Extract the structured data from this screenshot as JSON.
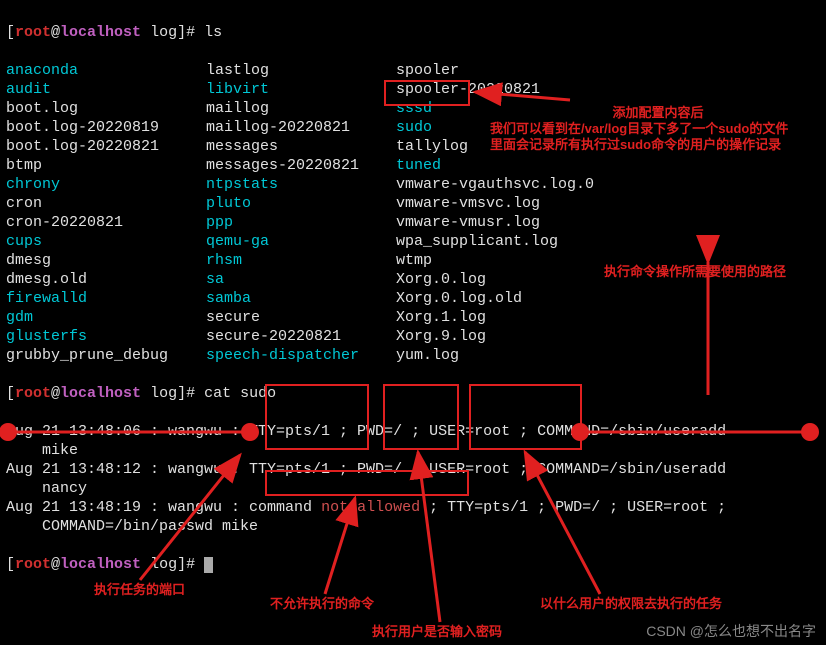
{
  "prompt": {
    "open": "[",
    "user": "root",
    "at": "@",
    "host": "localhost",
    "dir": " log",
    "close": "]# "
  },
  "cmd1": "ls",
  "cmd2": "cat sudo",
  "ls": [
    [
      "anaconda",
      "lastlog",
      "spooler"
    ],
    [
      "audit",
      "libvirt",
      "spooler-20220821"
    ],
    [
      "boot.log",
      "maillog",
      "sssd"
    ],
    [
      "boot.log-20220819",
      "maillog-20220821",
      "sudo"
    ],
    [
      "boot.log-20220821",
      "messages",
      "tallylog"
    ],
    [
      "btmp",
      "messages-20220821",
      "tuned"
    ],
    [
      "chrony",
      "ntpstats",
      "vmware-vgauthsvc.log.0"
    ],
    [
      "cron",
      "pluto",
      "vmware-vmsvc.log"
    ],
    [
      "cron-20220821",
      "ppp",
      "vmware-vmusr.log"
    ],
    [
      "cups",
      "qemu-ga",
      "wpa_supplicant.log"
    ],
    [
      "dmesg",
      "rhsm",
      "wtmp"
    ],
    [
      "dmesg.old",
      "sa",
      "Xorg.0.log"
    ],
    [
      "firewalld",
      "samba",
      "Xorg.0.log.old"
    ],
    [
      "gdm",
      "secure",
      "Xorg.1.log"
    ],
    [
      "glusterfs",
      "secure-20220821",
      "Xorg.9.log"
    ],
    [
      "grubby_prune_debug",
      "speech-dispatcher",
      "yum.log"
    ]
  ],
  "ls_colors": [
    [
      "cyan",
      "white",
      "white"
    ],
    [
      "cyan",
      "cyan",
      "white"
    ],
    [
      "white",
      "white",
      "cyan"
    ],
    [
      "white",
      "white",
      "cyan"
    ],
    [
      "white",
      "white",
      "white"
    ],
    [
      "white",
      "white",
      "cyan"
    ],
    [
      "cyan",
      "cyan",
      "white"
    ],
    [
      "white",
      "cyan",
      "white"
    ],
    [
      "white",
      "cyan",
      "white"
    ],
    [
      "cyan",
      "cyan",
      "white"
    ],
    [
      "white",
      "cyan",
      "white"
    ],
    [
      "white",
      "cyan",
      "white"
    ],
    [
      "cyan",
      "cyan",
      "white"
    ],
    [
      "cyan",
      "white",
      "white"
    ],
    [
      "cyan",
      "white",
      "white"
    ],
    [
      "white",
      "cyan",
      "white"
    ]
  ],
  "cat": [
    "Aug 21 13:48:06 : wangwu : TTY=pts/1 ; PWD=/ ; USER=root ; COMMAND=/sbin/useradd",
    "    mike",
    "Aug 21 13:48:12 : wangwu : TTY=pts/1 ; PWD=/ ; USER=root ; COMMAND=/sbin/useradd",
    "    nancy",
    "Aug 21 13:48:19 : wangwu : command not allowed ; TTY=pts/1 ; PWD=/ ; USER=root ;",
    "    COMMAND=/bin/passwd mike"
  ],
  "anno": {
    "top1": "添加配置内容后",
    "top2": "我们可以看到在/var/log目录下多了一个sudo的文件",
    "top3": "里面会记录所有执行过sudo命令的用户的操作记录",
    "path": "执行命令操作所需要使用的路径",
    "port": "执行任务的端口",
    "deny": "不允许执行的命令",
    "pwd": "执行用户是否输入密码",
    "user": "以什么用户的权限去执行的任务",
    "watermark_prefix": "CSDN @",
    "watermark_name": "怎么也想不出名字"
  },
  "colors": {
    "red": "#e02020"
  }
}
